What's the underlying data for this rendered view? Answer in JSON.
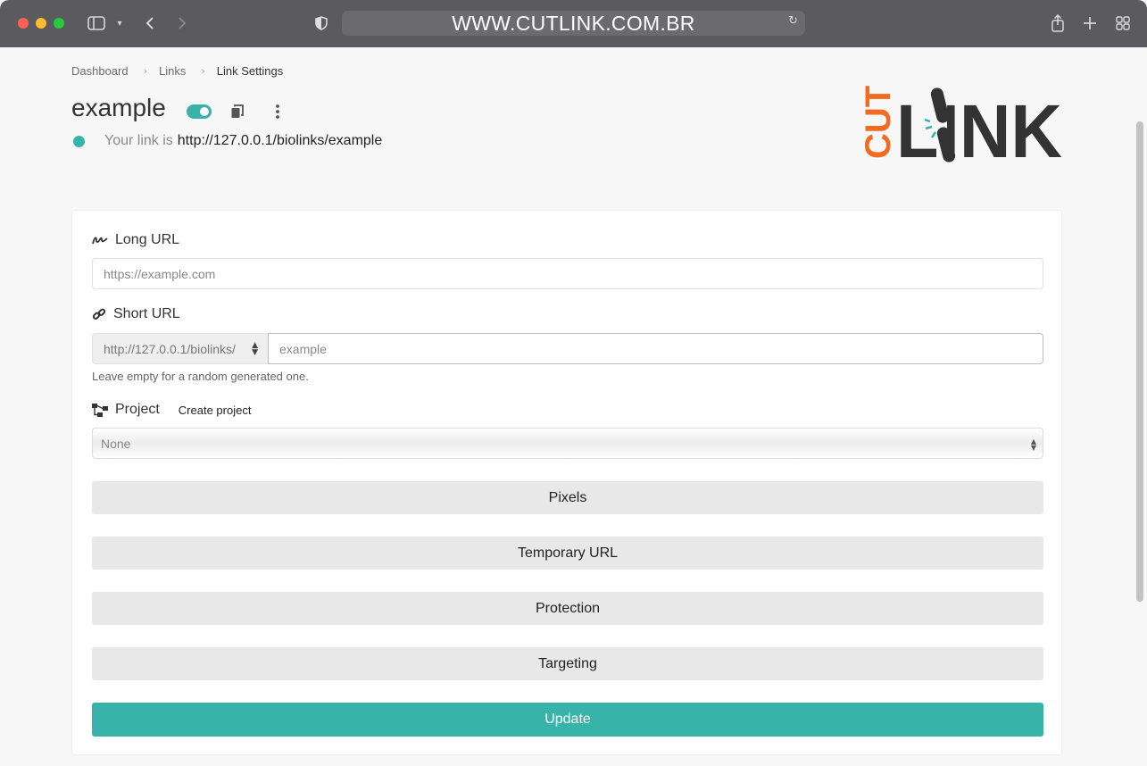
{
  "browser": {
    "address": "WWW.CUTLINK.COM.BR"
  },
  "breadcrumb": {
    "items": [
      "Dashboard",
      "Links",
      "Link Settings"
    ]
  },
  "header": {
    "title": "example",
    "link_prefix": "Your link is",
    "link_url": "http://127.0.0.1/biolinks/example",
    "enabled": true
  },
  "logo": {
    "text_cut": "CUT",
    "text_link": "LINK",
    "accent_color": "#f26b21",
    "dark_color": "#333333"
  },
  "form": {
    "long_url": {
      "label": "Long URL",
      "placeholder": "https://example.com"
    },
    "short_url": {
      "label": "Short URL",
      "prefix_selected": "http://127.0.0.1/biolinks/",
      "placeholder": "example",
      "help": "Leave empty for a random generated one."
    },
    "project": {
      "label": "Project",
      "create_link": "Create project",
      "selected": "None"
    },
    "sections": [
      "Pixels",
      "Temporary URL",
      "Protection",
      "Targeting"
    ],
    "submit_label": "Update"
  },
  "colors": {
    "accent": "#37b3a9",
    "section_bg": "#e8e8e8"
  }
}
